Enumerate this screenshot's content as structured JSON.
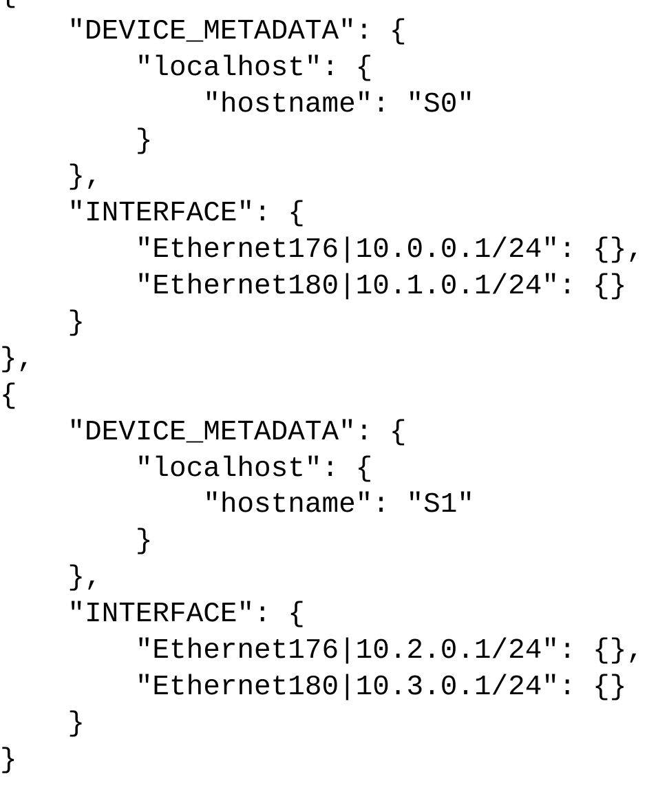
{
  "code": {
    "lines": [
      "{",
      "    \"DEVICE_METADATA\": {",
      "        \"localhost\": {",
      "            \"hostname\": \"S0\"",
      "        }",
      "    },",
      "    \"INTERFACE\": {",
      "        \"Ethernet176|10.0.0.1/24\": {},",
      "        \"Ethernet180|10.1.0.1/24\": {}",
      "    }",
      "},",
      "{",
      "    \"DEVICE_METADATA\": {",
      "        \"localhost\": {",
      "            \"hostname\": \"S1\"",
      "        }",
      "    },",
      "    \"INTERFACE\": {",
      "        \"Ethernet176|10.2.0.1/24\": {},",
      "        \"Ethernet180|10.3.0.1/24\": {}",
      "    }",
      "}"
    ]
  }
}
